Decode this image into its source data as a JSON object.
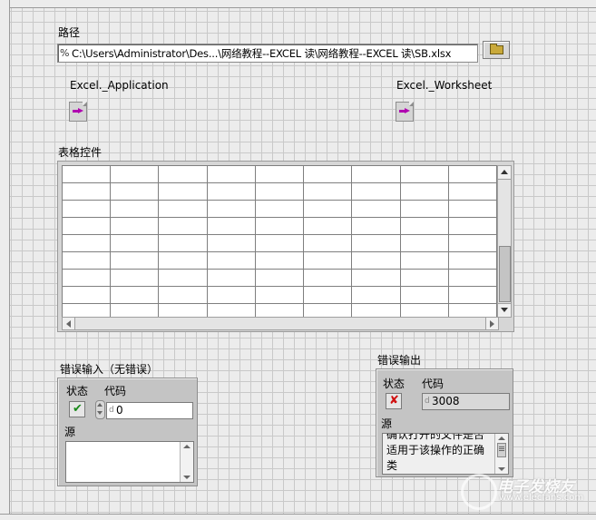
{
  "path": {
    "label": "路径",
    "type_glyph": "%",
    "value": "C:\\Users\\Administrator\\Des...\\网络教程--EXCEL 读\\网络教程--EXCEL 读\\SB.xlsx"
  },
  "refnums": {
    "application_label": "Excel._Application",
    "worksheet_label": "Excel._Worksheet",
    "icon": "refnum-arrow-icon"
  },
  "table": {
    "label": "表格控件",
    "rows": 9,
    "columns": 9
  },
  "error_in": {
    "label": "错误输入（无错误）",
    "status_label": "状态",
    "code_label": "代码",
    "status_glyph": "✔",
    "code_prefix": "d",
    "code_value": "0",
    "source_label": "源",
    "source_value": ""
  },
  "error_out": {
    "label": "错误输出",
    "status_label": "状态",
    "code_label": "代码",
    "status_glyph": "✘",
    "code_prefix": "d",
    "code_value": "3008",
    "source_label": "源",
    "source_value": "确认打开的文件是否适用于该操作的正确类"
  },
  "watermark": {
    "text": "电子发烧友",
    "url": "www.elecfans.com"
  },
  "colors": {
    "grid_background": "#ececec",
    "refnum_arrow": "#b000b0",
    "status_ok": "#1a8a1a",
    "status_error": "#d01010"
  }
}
